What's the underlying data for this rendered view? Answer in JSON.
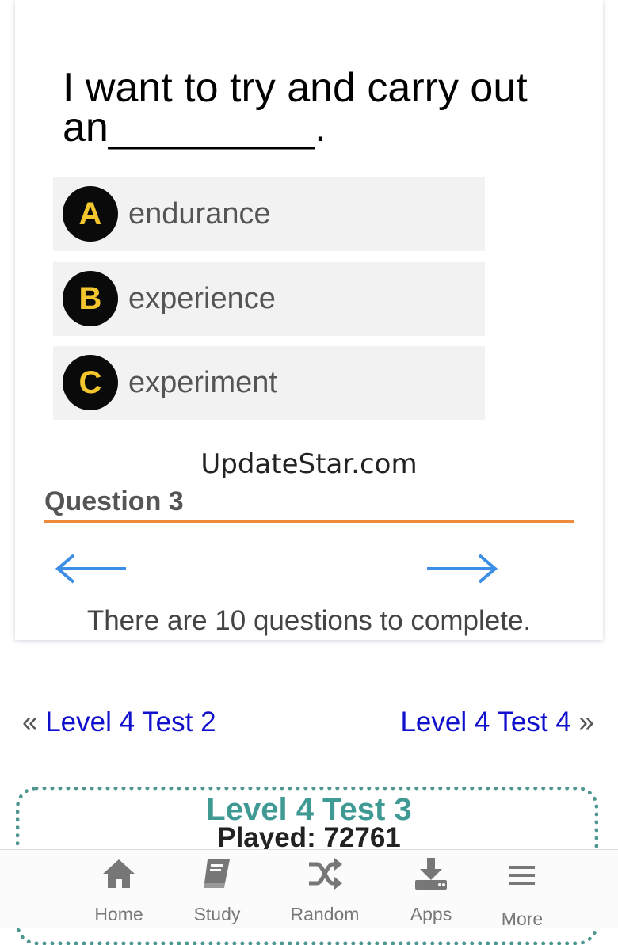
{
  "quiz": {
    "question_text": "I want to try and carry out an_________.",
    "options": [
      {
        "letter": "A",
        "text": "endurance"
      },
      {
        "letter": "B",
        "text": "experience"
      },
      {
        "letter": "C",
        "text": "experiment"
      }
    ],
    "watermark": "UpdateStar.com",
    "question_number": "Question 3",
    "progress_text": "There are 10 questions to complete."
  },
  "nav": {
    "prev_mark": "«",
    "prev_label": "Level 4 Test 2",
    "next_label": "Level 4 Test 4",
    "next_mark": "»"
  },
  "test_box": {
    "title": "Level 4 Test 3",
    "played": "Played: 72761"
  },
  "bottom_nav": [
    {
      "label": "Home",
      "icon": "home-icon"
    },
    {
      "label": "Study",
      "icon": "book-icon"
    },
    {
      "label": "Random",
      "icon": "shuffle-icon"
    },
    {
      "label": "Apps",
      "icon": "download-icon"
    },
    {
      "label": "More",
      "icon": "menu-icon"
    }
  ],
  "colors": {
    "option_bg": "#f2f2f2",
    "letter_circle": "#0a0a0a",
    "letter_text": "#f2c62c",
    "divider": "#ee8a3c",
    "arrow": "#3d8ee6",
    "link": "#1010cc",
    "box_accent": "#3f9a94"
  }
}
